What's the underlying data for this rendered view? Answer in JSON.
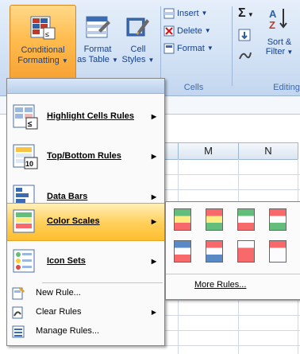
{
  "ribbon": {
    "conditional_formatting": {
      "line1": "Conditional",
      "line2": "Formatting",
      "caret": "▼"
    },
    "format_as_table": {
      "line1": "Format",
      "line2": "as Table",
      "caret": "▼"
    },
    "cell_styles": {
      "line1": "Cell",
      "line2": "Styles",
      "caret": "▼"
    },
    "cells": {
      "insert": "Insert",
      "delete": "Delete",
      "format": "Format",
      "group_label": "Cells"
    },
    "editing": {
      "sum_symbol": "Σ",
      "sort_filter_line1": "Sort &",
      "sort_filter_line2": "Filter",
      "group_label": "Editing"
    }
  },
  "sheet": {
    "columns": [
      "M",
      "N"
    ]
  },
  "menu": {
    "items": [
      {
        "label": "Highlight Cells Rules",
        "icon": "highlight-cells-icon"
      },
      {
        "label": "Top/Bottom Rules",
        "icon": "top-bottom-icon"
      },
      {
        "label": "Data Bars",
        "icon": "data-bars-icon"
      },
      {
        "label": "Color Scales",
        "icon": "color-scales-icon"
      },
      {
        "label": "Icon Sets",
        "icon": "icon-sets-icon"
      }
    ],
    "small_items": [
      {
        "label": "New Rule...",
        "icon": "new-rule-icon"
      },
      {
        "label": "Clear Rules",
        "icon": "clear-rules-icon"
      },
      {
        "label": "Manage Rules...",
        "icon": "manage-rules-icon"
      }
    ],
    "highlight_color": "#ffcf55"
  },
  "gallery": {
    "more_rules": "More Rules...",
    "colors": {
      "green": "#63be7b",
      "yellow": "#ffeb84",
      "red": "#f8696b",
      "blue": "#5a8ac6",
      "white": "#fcfcff"
    }
  }
}
